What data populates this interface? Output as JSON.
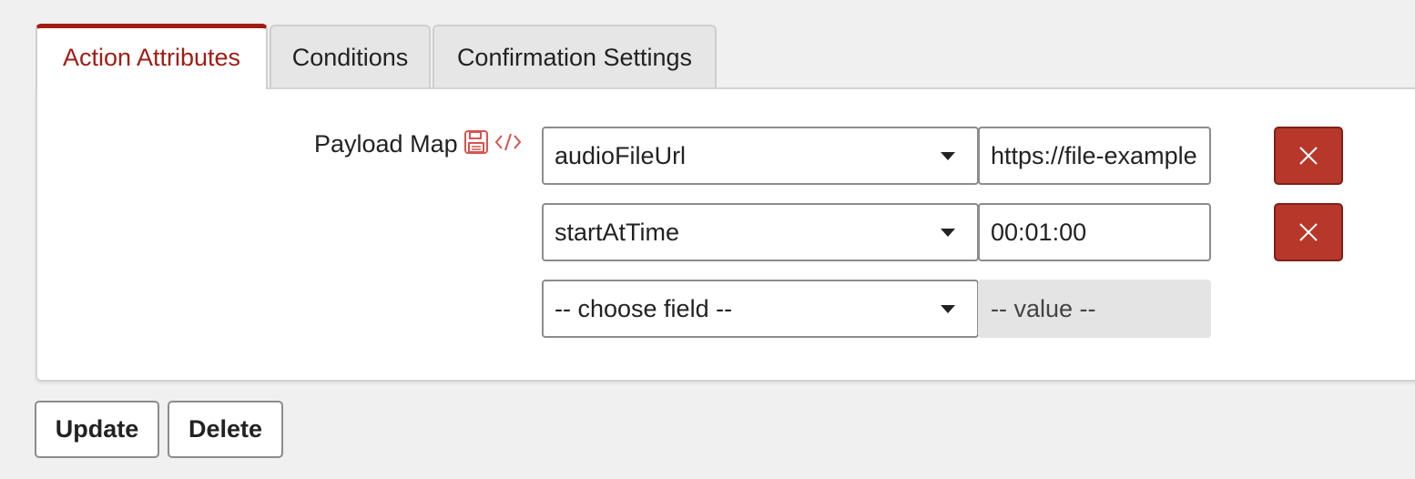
{
  "tabs": [
    {
      "label": "Action Attributes",
      "active": true
    },
    {
      "label": "Conditions",
      "active": false
    },
    {
      "label": "Confirmation Settings",
      "active": false
    }
  ],
  "payload_map": {
    "label": "Payload Map",
    "icons": [
      "save-icon",
      "code-icon"
    ],
    "rows": [
      {
        "field": "audioFileUrl",
        "value": "https://file-example",
        "removable": true
      },
      {
        "field": "startAtTime",
        "value": "00:01:00",
        "removable": true
      },
      {
        "field": "-- choose field --",
        "value_placeholder": "-- value --",
        "removable": false
      }
    ]
  },
  "buttons": {
    "update": "Update",
    "delete": "Delete"
  },
  "colors": {
    "accent": "#a11d13",
    "remove_button": "#b8372b",
    "icon": "#d9534f"
  }
}
